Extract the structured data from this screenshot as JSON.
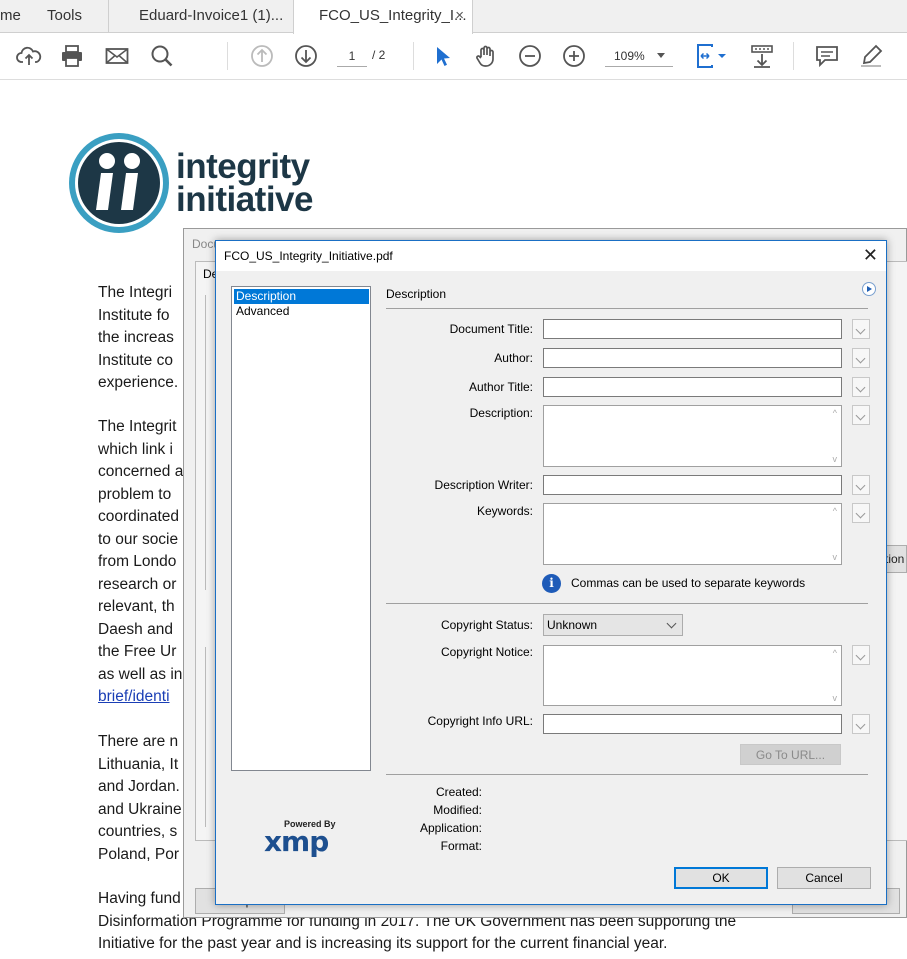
{
  "tabs": {
    "home": "me",
    "tools": "Tools",
    "invoice": "Eduard-Invoice1 (1)...",
    "current": "FCO_US_Integrity_I...",
    "close": "×"
  },
  "toolbar": {
    "page_current": "1",
    "page_total": "/ 2",
    "zoom": "109%"
  },
  "document": {
    "logo_line1": "integrity",
    "logo_line2": "initiative",
    "para1": [
      "The Integri",
      "Institute fo",
      "the increas",
      "Institute co",
      "experience."
    ],
    "para2": [
      "The Integrit",
      "which link i",
      "concerned a",
      "problem to",
      "coordinated",
      "to our socie",
      "from Londo",
      "research or",
      "relevant, th",
      "Daesh and",
      "the Free Ur",
      "as well as in"
    ],
    "para2_link": "brief/identi",
    "para3": [
      "There are n",
      "Lithuania, It",
      "and Jordan.",
      "and Ukraine",
      "countries, s",
      "Poland, Por"
    ],
    "para4": [
      "Having fund",
      "Disinformation Programme for funding in 2017.  The UK Government has been supporting the",
      "Initiative for the past year and is increasing its support for the current financial year."
    ]
  },
  "bg_dialog": {
    "title": "Docu",
    "tab": "De",
    "help_button": "Help",
    "ok_button": "Ok",
    "right_button": "tion"
  },
  "dialog": {
    "title": "FCO_US_Integrity_Initiative.pdf",
    "close": "✕",
    "nav": [
      "Description",
      "Advanced"
    ],
    "panel_title": "Description",
    "fields": {
      "document_title": {
        "label": "Document Title:",
        "value": ""
      },
      "author": {
        "label": "Author:",
        "value": ""
      },
      "author_title": {
        "label": "Author Title:",
        "value": ""
      },
      "description": {
        "label": "Description:",
        "value": ""
      },
      "description_writer": {
        "label": "Description Writer:",
        "value": ""
      },
      "keywords": {
        "label": "Keywords:",
        "value": ""
      },
      "copyright_status": {
        "label": "Copyright Status:",
        "value": "Unknown"
      },
      "copyright_notice": {
        "label": "Copyright Notice:",
        "value": ""
      },
      "copyright_url": {
        "label": "Copyright Info URL:",
        "value": ""
      }
    },
    "keywords_hint": "Commas can be used to separate keywords",
    "go_to_url": "Go To URL...",
    "meta": {
      "created": "Created:",
      "modified": "Modified:",
      "application": "Application:",
      "format": "Format:"
    },
    "xmp_powered": "Powered By",
    "xmp_logo": "xmp",
    "ok": "OK",
    "cancel": "Cancel"
  },
  "colors": {
    "accent": "#0078d7",
    "logo_dark": "#1d3746",
    "logo_ring": "#3a9fc2",
    "link": "#1a3eb5"
  }
}
